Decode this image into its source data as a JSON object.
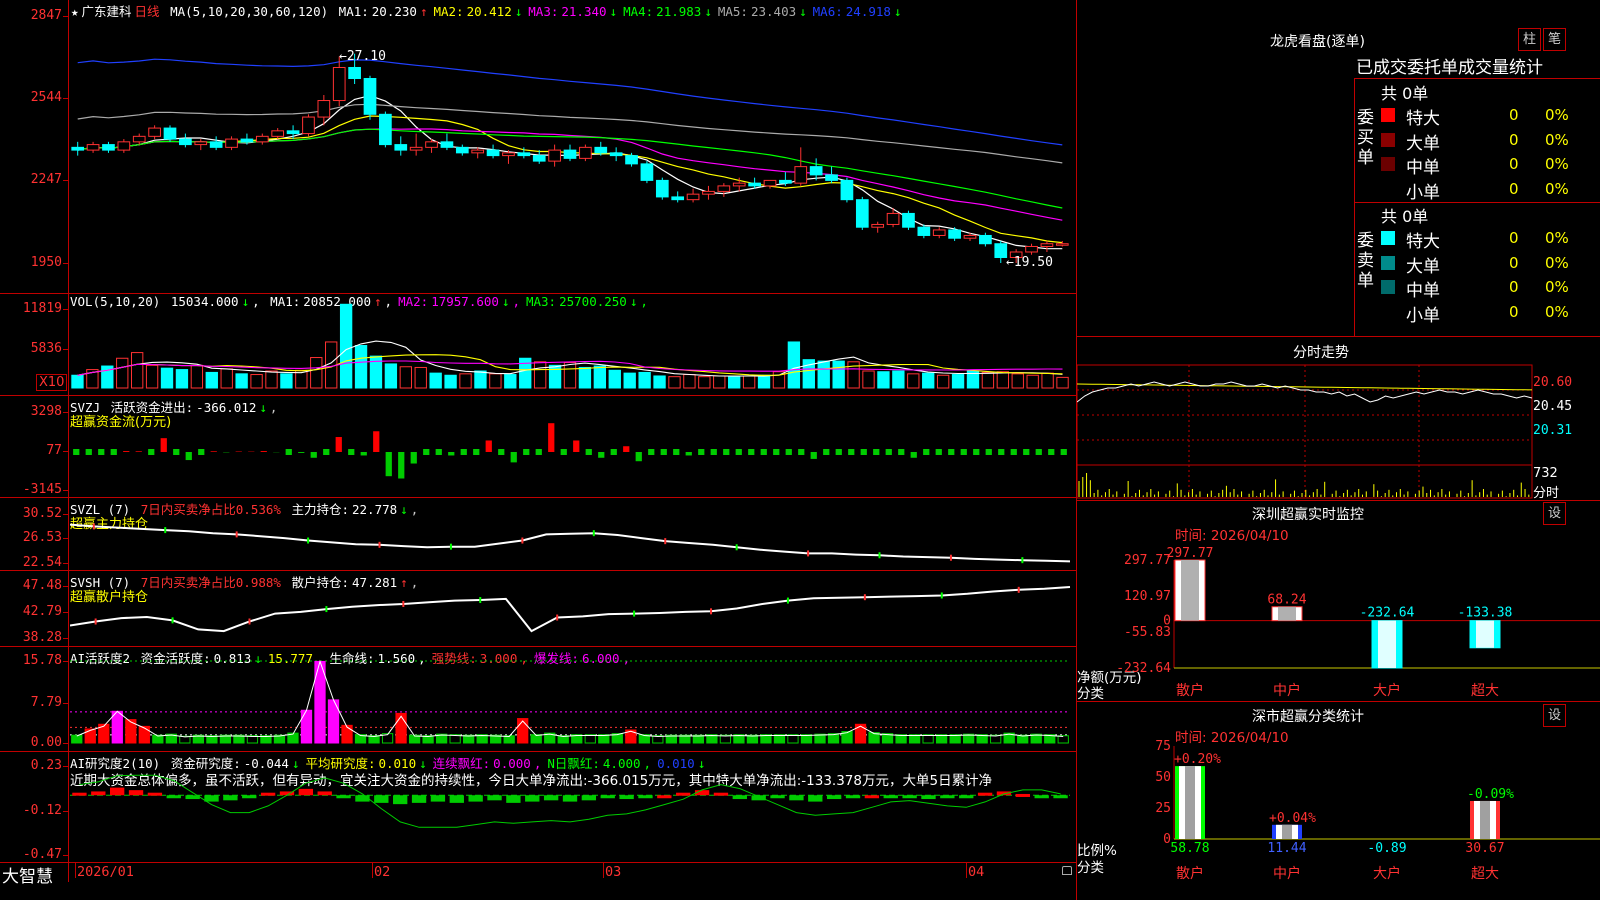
{
  "colors": {
    "up": "#ff3232",
    "down": "#00ffff",
    "grid": "#c00000",
    "bg": "#000000"
  },
  "main": {
    "star": "★",
    "stock_name": "广东建科",
    "period": "日线",
    "ma_title": "MA(5,10,20,30,60,120)",
    "ma": [
      {
        "label": "MA1:",
        "value": "20.230",
        "arrow": "↑"
      },
      {
        "label": "MA2:",
        "value": "20.412",
        "arrow": "↓"
      },
      {
        "label": "MA3:",
        "value": "21.340",
        "arrow": "↓"
      },
      {
        "label": "MA4:",
        "value": "21.983",
        "arrow": "↓"
      },
      {
        "label": "MA5:",
        "value": "23.403",
        "arrow": "↓"
      },
      {
        "label": "MA6:",
        "value": "24.918",
        "arrow": "↓"
      }
    ],
    "yticks": [
      "2847",
      "2544",
      "2247",
      "1950"
    ],
    "high_label": "27.10",
    "low_label": "19.50"
  },
  "vol": {
    "title": "VOL(5,10,20)",
    "value": "15034.000",
    "arrow": "↓",
    "ma": [
      {
        "label": "MA1:",
        "value": "20852.000",
        "arrow": "↑"
      },
      {
        "label": "MA2:",
        "value": "17957.600",
        "arrow": "↓"
      },
      {
        "label": "MA3:",
        "value": "25700.250",
        "arrow": "↓"
      }
    ],
    "yticks": [
      "11819",
      "5836"
    ],
    "unit": "X10"
  },
  "svzj": {
    "title": "SVZJ",
    "label": "活跃资金进出:",
    "value": "-366.012",
    "arrow": "↓",
    "sub": "超赢资金流(万元)",
    "yticks": [
      "3298",
      "77",
      "-3145"
    ]
  },
  "svzl": {
    "title": "SVZL (7)",
    "ratio": "7日内买卖净占比0.536%",
    "label": "主力持仓:",
    "value": "22.778",
    "arrow": "↓",
    "sub": "超赢主力持仓",
    "yticks": [
      "30.52",
      "26.53",
      "22.54"
    ]
  },
  "svsh": {
    "title": "SVSH (7)",
    "ratio": "7日内买卖净占比0.988%",
    "label": "散户持仓:",
    "value": "47.281",
    "arrow": "↑",
    "sub": "超赢散户持仓",
    "yticks": [
      "47.48",
      "42.79",
      "38.28"
    ]
  },
  "ai_active": {
    "title": "AI活跃度2",
    "items": [
      {
        "label": "资金活跃度:",
        "value": "0.813",
        "arrow": "↓",
        "color": "wht"
      },
      {
        "label": "",
        "value": "15.777",
        "arrow": ",",
        "color": "yel"
      },
      {
        "label": "生命线:",
        "value": "1.560",
        "arrow": ",",
        "color": "wht"
      },
      {
        "label": "强势线:",
        "value": "3.000",
        "arrow": ",",
        "color": "red"
      },
      {
        "label": "爆发线:",
        "value": "6.000",
        "arrow": ",",
        "color": "mag"
      }
    ],
    "yticks": [
      "15.78",
      "7.79",
      "0.00"
    ]
  },
  "ai_research": {
    "title": "AI研究度2(10)",
    "items": [
      {
        "label": "资金研究度:",
        "value": "-0.044",
        "arrow": "↓",
        "color": "wht"
      },
      {
        "label": "平均研究度:",
        "value": "0.010",
        "arrow": "↓",
        "color": "yel"
      },
      {
        "label": "连续飘红:",
        "value": "0.000",
        "arrow": ",",
        "color": "mag"
      },
      {
        "label": "N日飘红:",
        "value": "4.000",
        "arrow": ",",
        "color": "grn"
      },
      {
        "label": "",
        "value": "0.010",
        "arrow": "↓",
        "color": "blu"
      }
    ],
    "commentary": "近期大资金总体偏多，虽不活跃，但有异动，宜关注大资金的持续性，今日大单净流出:-366.015万元，其中特大单净流出:-133.378万元，大单5日累计净",
    "yticks": [
      "0.23",
      "-0.12",
      "-0.47"
    ]
  },
  "bottom": {
    "brand": "大智慧",
    "dates": [
      "2026/01",
      "02",
      "03",
      "04"
    ]
  },
  "dragon": {
    "title": "龙虎看盘(逐单)",
    "btn_bar": "柱",
    "btn_pen": "笔",
    "tabs": [
      "已成交",
      "委托单",
      "成交量",
      "统计"
    ],
    "buy_group": {
      "label": "委买单",
      "total": "共 0单",
      "rows": [
        {
          "name": "特大",
          "count": "0",
          "pct": "0%",
          "color": "#ff0000"
        },
        {
          "name": "大单",
          "count": "0",
          "pct": "0%",
          "color": "#8b0000"
        },
        {
          "name": "中单",
          "count": "0",
          "pct": "0%",
          "color": "#6b0000"
        },
        {
          "name": "小单",
          "count": "0",
          "pct": "0%",
          "color": ""
        }
      ]
    },
    "sell_group": {
      "label": "委卖单",
      "total": "共 0单",
      "rows": [
        {
          "name": "特大",
          "count": "0",
          "pct": "0%",
          "color": "#00ffff"
        },
        {
          "name": "大单",
          "count": "0",
          "pct": "0%",
          "color": "#008b8b"
        },
        {
          "name": "中单",
          "count": "0",
          "pct": "0%",
          "color": "#006b6b"
        },
        {
          "name": "小单",
          "count": "0",
          "pct": "0%",
          "color": ""
        }
      ]
    }
  },
  "intraday": {
    "title": "分时走势",
    "yticks": [
      "20.60",
      "20.45",
      "20.31"
    ],
    "vol_tick": "732",
    "vol_label": "分时"
  },
  "sz_monitor": {
    "title": "深圳超赢实时监控",
    "btn": "设",
    "time": "时间: 2026/04/10",
    "yticks": [
      "297.77",
      "120.97",
      "0",
      "-55.83",
      "-232.64"
    ],
    "ylabel": "净额(万元)",
    "xlabel": "分类",
    "categories": [
      "散户",
      "中户",
      "大户",
      "超大"
    ],
    "values": [
      "297.77",
      "68.24",
      "-232.64",
      "-133.38"
    ]
  },
  "sz_class": {
    "title": "深市超赢分类统计",
    "btn": "设",
    "time": "时间: 2026/04/10",
    "yticks": [
      "75",
      "50",
      "25",
      "0"
    ],
    "ylabel": "比例%",
    "xlabel": "分类",
    "categories": [
      "散户",
      "中户",
      "大户",
      "超大"
    ],
    "top_labels": [
      "+0.20%",
      "+0.04%",
      "",
      "-0.09%"
    ],
    "values": [
      "58.78",
      "11.44",
      "-0.89",
      "30.67"
    ]
  },
  "chart_data": [
    {
      "type": "candlestick",
      "title": "广东建科 日线",
      "x": [
        "2026/01",
        "02",
        "03",
        "04"
      ],
      "ylim": [
        19.5,
        28.47
      ],
      "yticks_printed": [
        "2847",
        "2544",
        "2247",
        "1950"
      ],
      "high": 27.1,
      "low": 19.5,
      "candles": [
        [
          23.7,
          23.9,
          23.4,
          23.6
        ],
        [
          23.6,
          23.9,
          23.5,
          23.8
        ],
        [
          23.8,
          23.9,
          23.5,
          23.6
        ],
        [
          23.6,
          24.0,
          23.5,
          23.9
        ],
        [
          23.9,
          24.2,
          23.8,
          24.1
        ],
        [
          24.1,
          24.5,
          24.0,
          24.4
        ],
        [
          24.4,
          24.5,
          23.9,
          24.0
        ],
        [
          24.0,
          24.2,
          23.7,
          23.8
        ],
        [
          23.8,
          24.0,
          23.6,
          23.9
        ],
        [
          23.9,
          24.1,
          23.6,
          23.7
        ],
        [
          23.7,
          24.1,
          23.6,
          24.0
        ],
        [
          24.0,
          24.2,
          23.8,
          23.9
        ],
        [
          23.9,
          24.2,
          23.8,
          24.1
        ],
        [
          24.1,
          24.4,
          24.0,
          24.3
        ],
        [
          24.3,
          24.5,
          24.0,
          24.2
        ],
        [
          24.2,
          24.9,
          24.1,
          24.8
        ],
        [
          24.8,
          25.6,
          24.5,
          25.4
        ],
        [
          25.4,
          27.0,
          25.2,
          26.6
        ],
        [
          26.6,
          27.1,
          26.0,
          26.2
        ],
        [
          26.2,
          26.3,
          24.7,
          24.9
        ],
        [
          24.9,
          25.0,
          23.7,
          23.8
        ],
        [
          23.8,
          24.1,
          23.4,
          23.6
        ],
        [
          23.6,
          24.2,
          23.4,
          23.7
        ],
        [
          23.7,
          24.0,
          23.5,
          23.9
        ],
        [
          23.9,
          24.2,
          23.6,
          23.7
        ],
        [
          23.7,
          23.8,
          23.4,
          23.5
        ],
        [
          23.5,
          23.7,
          23.3,
          23.6
        ],
        [
          23.6,
          23.8,
          23.3,
          23.4
        ],
        [
          23.4,
          23.6,
          23.1,
          23.5
        ],
        [
          23.5,
          23.7,
          23.3,
          23.4
        ],
        [
          23.4,
          23.6,
          23.1,
          23.2
        ],
        [
          23.2,
          23.8,
          23.0,
          23.6
        ],
        [
          23.6,
          23.8,
          23.2,
          23.3
        ],
        [
          23.3,
          23.8,
          23.2,
          23.7
        ],
        [
          23.7,
          23.9,
          23.4,
          23.5
        ],
        [
          23.5,
          23.7,
          23.2,
          23.4
        ],
        [
          23.4,
          23.5,
          23.0,
          23.1
        ],
        [
          23.1,
          23.2,
          22.4,
          22.5
        ],
        [
          22.5,
          22.6,
          21.8,
          21.9
        ],
        [
          21.9,
          22.1,
          21.7,
          21.8
        ],
        [
          21.8,
          22.2,
          21.7,
          22.0
        ],
        [
          22.0,
          22.3,
          21.8,
          22.1
        ],
        [
          22.1,
          22.4,
          21.9,
          22.3
        ],
        [
          22.3,
          22.6,
          22.1,
          22.4
        ],
        [
          22.4,
          22.6,
          22.2,
          22.3
        ],
        [
          22.3,
          22.5,
          22.2,
          22.5
        ],
        [
          22.5,
          22.8,
          22.3,
          22.4
        ],
        [
          22.4,
          23.7,
          22.3,
          23.0
        ],
        [
          23.0,
          23.3,
          22.5,
          22.7
        ],
        [
          22.7,
          23.0,
          22.4,
          22.5
        ],
        [
          22.5,
          22.6,
          21.7,
          21.8
        ],
        [
          21.8,
          21.9,
          20.7,
          20.8
        ],
        [
          20.8,
          21.0,
          20.6,
          20.9
        ],
        [
          20.9,
          21.5,
          20.8,
          21.3
        ],
        [
          21.3,
          21.4,
          20.7,
          20.8
        ],
        [
          20.8,
          20.9,
          20.4,
          20.5
        ],
        [
          20.5,
          20.8,
          20.4,
          20.7
        ],
        [
          20.7,
          20.8,
          20.3,
          20.4
        ],
        [
          20.4,
          20.6,
          20.3,
          20.5
        ],
        [
          20.5,
          20.6,
          20.1,
          20.2
        ],
        [
          20.2,
          20.3,
          19.5,
          19.7
        ],
        [
          19.7,
          20.0,
          19.5,
          19.9
        ],
        [
          19.9,
          20.2,
          19.8,
          20.1
        ],
        [
          20.1,
          20.3,
          19.9,
          20.2
        ],
        [
          20.2,
          20.3,
          20.1,
          20.2
        ]
      ],
      "candle_fields": [
        "open",
        "high",
        "low",
        "close"
      ],
      "series": [
        {
          "name": "MA1",
          "last": 20.23
        },
        {
          "name": "MA2",
          "last": 20.412
        },
        {
          "name": "MA3",
          "last": 21.34
        },
        {
          "name": "MA4",
          "last": 21.983
        },
        {
          "name": "MA5",
          "last": 23.403
        },
        {
          "name": "MA6",
          "last": 24.918
        }
      ]
    },
    {
      "type": "bar",
      "title": "VOL(5,10,20)",
      "ylim": [
        0,
        12000
      ],
      "values": [
        1800,
        2600,
        3100,
        4200,
        5000,
        3200,
        2800,
        2600,
        3200,
        2200,
        2700,
        2000,
        1900,
        2400,
        2000,
        2500,
        4300,
        6500,
        11819,
        6000,
        4500,
        3400,
        3000,
        2900,
        2100,
        1800,
        2000,
        2400,
        2000,
        1900,
        4200,
        3700,
        3200,
        3600,
        2900,
        3100,
        2500,
        2100,
        2200,
        1700,
        1600,
        1900,
        1600,
        1700,
        1600,
        1700,
        1800,
        2300,
        6500,
        4000,
        3800,
        3800,
        3700,
        2400,
        2300,
        2400,
        2000,
        2100,
        1800,
        1900,
        2400,
        2200,
        2300,
        2000,
        1800,
        2100,
        1500
      ]
    },
    {
      "type": "bar",
      "title": "SVZJ 超赢资金流(万元)",
      "ylim": [
        -3145,
        3298
      ],
      "values": [
        0,
        0,
        0,
        0,
        80,
        60,
        0,
        1200,
        0,
        -700,
        0,
        60,
        -30,
        40,
        30,
        80,
        -20,
        0,
        -80,
        -500,
        0,
        1300,
        0,
        -300,
        1800,
        -2100,
        -2300,
        -1000,
        0,
        0,
        -300,
        0,
        0,
        1000,
        0,
        -900,
        0,
        0,
        2500,
        0,
        1000,
        0,
        -500,
        0,
        500,
        -800,
        0,
        0,
        0,
        -300,
        0,
        0,
        0,
        0,
        0,
        0,
        0,
        0,
        0,
        -600,
        0,
        0,
        0,
        0,
        0,
        0,
        0,
        -500,
        0,
        0,
        0,
        0,
        0,
        0,
        0,
        0,
        0,
        0,
        0,
        0
      ]
    },
    {
      "type": "line",
      "title": "SVZL 超赢主力持仓",
      "ylim": [
        22.54,
        30.52
      ],
      "values": [
        28.8,
        28.5,
        28.3,
        28.1,
        27.9,
        27.7,
        27.4,
        27.2,
        26.9,
        26.6,
        26.2,
        25.9,
        25.6,
        25.5,
        25.3,
        25.1,
        25.2,
        25.2,
        25.7,
        26.2,
        27.2,
        27.3,
        27.4,
        27.1,
        26.6,
        26.1,
        25.8,
        25.5,
        25.1,
        24.7,
        24.4,
        24.1,
        24.1,
        23.9,
        23.8,
        23.6,
        23.5,
        23.4,
        23.2,
        23.1,
        23.0,
        22.9,
        22.8
      ]
    },
    {
      "type": "line",
      "title": "SVSH 超赢散户持仓",
      "ylim": [
        38.28,
        47.48
      ],
      "values": [
        40.5,
        41.2,
        41.8,
        42.0,
        41.4,
        39.8,
        39.5,
        41.2,
        42.6,
        42.9,
        43.4,
        43.8,
        44.1,
        44.3,
        44.6,
        44.9,
        45.0,
        45.2,
        39.5,
        41.9,
        42.1,
        42.5,
        42.6,
        42.7,
        42.9,
        43.0,
        43.5,
        44.3,
        44.9,
        45.3,
        45.4,
        45.5,
        45.6,
        45.7,
        45.8,
        46.1,
        46.5,
        46.8,
        47.0,
        47.3
      ]
    },
    {
      "type": "bar",
      "title": "AI活跃度2",
      "ylim": [
        0,
        15.78
      ],
      "values": [
        1.5,
        2.7,
        3.6,
        6.1,
        4.5,
        3.2,
        1.5,
        1.7,
        1.3,
        1.5,
        1.4,
        1.5,
        1.5,
        1.4,
        1.4,
        1.5,
        1.9,
        6.3,
        15.7,
        8.3,
        3.4,
        1.6,
        1.4,
        1.8,
        5.7,
        1.5,
        1.4,
        1.7,
        1.6,
        1.5,
        1.6,
        1.5,
        1.4,
        4.7,
        1.6,
        1.9,
        1.4,
        1.6,
        1.6,
        1.6,
        1.8,
        2.5,
        1.6,
        1.4,
        1.5,
        1.5,
        1.5,
        1.6,
        1.5,
        1.6,
        1.5,
        1.6,
        1.6,
        1.6,
        1.6,
        1.7,
        1.8,
        2.2,
        3.6,
        2.0,
        1.8,
        1.6,
        1.6,
        1.6,
        1.6,
        1.6,
        1.7,
        1.6,
        1.5,
        1.9,
        1.5,
        1.7,
        1.6,
        1.4
      ]
    },
    {
      "type": "bar",
      "title": "AI研究度2(10)",
      "ylim": [
        -0.47,
        0.23
      ],
      "values": [
        0.02,
        0.03,
        0.06,
        0.04,
        0.02,
        -0.01,
        -0.03,
        -0.05,
        -0.04,
        -0.01,
        0.02,
        0.03,
        0.05,
        0.03,
        -0.02,
        -0.05,
        -0.06,
        -0.07,
        -0.06,
        -0.05,
        -0.06,
        -0.05,
        -0.04,
        -0.06,
        -0.05,
        -0.04,
        -0.05,
        -0.04,
        -0.02,
        -0.03,
        -0.02,
        0.0,
        0.02,
        0.04,
        0.02,
        -0.03,
        -0.04,
        -0.02,
        -0.04,
        -0.05,
        -0.03,
        -0.01,
        0.0,
        -0.01,
        -0.02,
        -0.03,
        -0.02,
        -0.02,
        0.02,
        0.03,
        0.01,
        -0.02,
        -0.01
      ]
    },
    {
      "type": "bar",
      "title": "深圳超赢实时监控",
      "categories": [
        "散户",
        "中户",
        "大户",
        "超大"
      ],
      "values": [
        297.77,
        68.24,
        -232.64,
        -133.38
      ],
      "ylim": [
        -232.64,
        297.77
      ],
      "ylabel": "净额(万元)",
      "xlabel": "分类"
    },
    {
      "type": "bar",
      "title": "深市超赢分类统计",
      "categories": [
        "散户",
        "中户",
        "大户",
        "超大"
      ],
      "values": [
        58.78,
        11.44,
        -0.89,
        30.67
      ],
      "ylim": [
        0,
        75
      ],
      "ylabel": "比例%",
      "xlabel": "分类"
    }
  ]
}
